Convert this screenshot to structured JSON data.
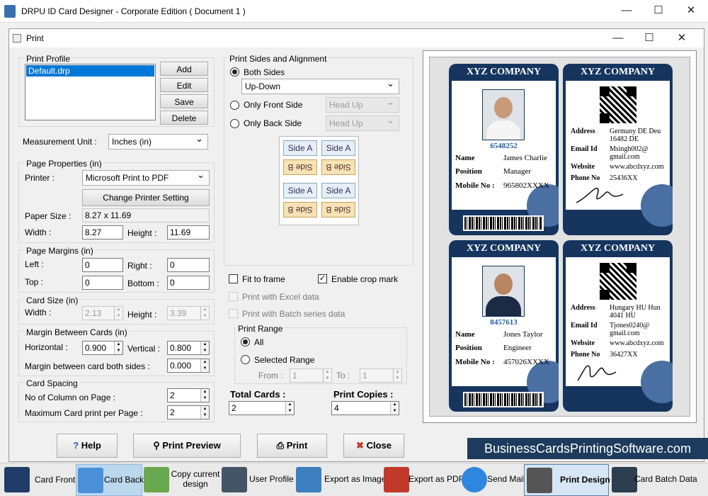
{
  "app": {
    "title": "DRPU ID Card Designer - Corporate Edition ( Document 1 )"
  },
  "dialog": {
    "title": "Print"
  },
  "print_profile": {
    "label": "Print Profile",
    "items": [
      "Default.drp"
    ],
    "add": "Add",
    "edit": "Edit",
    "save": "Save",
    "delete": "Delete"
  },
  "measurement": {
    "label": "Measurement Unit :",
    "value": "Inches (in)"
  },
  "page_properties": {
    "label": "Page Properties (in)",
    "printer_label": "Printer :",
    "printer": "Microsoft Print to PDF",
    "change_printer": "Change Printer Setting",
    "paper_size_label": "Paper Size :",
    "paper_size": "8.27 x 11.69",
    "width_label": "Width :",
    "width": "8.27",
    "height_label": "Height :",
    "height": "11.69"
  },
  "page_margins": {
    "label": "Page Margins (in)",
    "left_label": "Left :",
    "left": "0",
    "right_label": "Right :",
    "right": "0",
    "top_label": "Top :",
    "top": "0",
    "bottom_label": "Bottom :",
    "bottom": "0"
  },
  "card_size": {
    "label": "Card Size (in)",
    "width_label": "Width :",
    "width": "2.13",
    "height_label": "Height :",
    "height": "3.39"
  },
  "margin_between": {
    "label": "Margin Between Cards (in)",
    "horizontal_label": "Horizontal :",
    "horizontal": "0.900",
    "vertical_label": "Vertical :",
    "vertical": "0.800",
    "both_sides_label": "Margin between card both sides :",
    "both_sides": "0.000"
  },
  "card_spacing": {
    "label": "Card Spacing",
    "columns_label": "No of Column on Page :",
    "columns": "2",
    "max_label": "Maximum Card print per Page :",
    "max": "2"
  },
  "sides": {
    "label": "Print Sides and Alignment",
    "both": "Both Sides",
    "both_mode": "Up-Down",
    "front": "Only Front Side",
    "front_mode": "Head Up",
    "back": "Only Back Side",
    "back_mode": "Head Up",
    "side_a": "Side A",
    "side_b": "Side B"
  },
  "options": {
    "fit": "Fit to frame",
    "crop": "Enable crop mark",
    "excel": "Print with Excel data",
    "batch": "Print with Batch series data"
  },
  "range": {
    "label": "Print Range",
    "all": "All",
    "selected": "Selected Range",
    "from_label": "From :",
    "from": "1",
    "to_label": "To :",
    "to": "1"
  },
  "totals": {
    "cards_label": "Total Cards :",
    "cards": "2",
    "copies_label": "Print Copies :",
    "copies": "4"
  },
  "buttons": {
    "help": "Help",
    "preview": "Print Preview",
    "print": "Print",
    "close": "Close"
  },
  "cards": [
    {
      "company": "XYZ COMPANY",
      "id": "6548252",
      "name_label": "Name",
      "name": "James Charlie",
      "position_label": "Position",
      "position": "Manager",
      "mobile_label": "Mobile No :",
      "mobile": "965802XXXX"
    },
    {
      "company": "XYZ COMPANY",
      "address_label": "Address",
      "address": "Germany DE Deu 16482 DE",
      "email_label": "Email Id",
      "email": "Msingh002@ gmail.com",
      "website_label": "Website",
      "website": "www.abcdxyz.com",
      "phone_label": "Phone No",
      "phone": "25436XX"
    },
    {
      "company": "XYZ COMPANY",
      "id": "8457613",
      "name_label": "Name",
      "name": "Jones Taylor",
      "position_label": "Position",
      "position": "Engineer",
      "mobile_label": "Mobile No :",
      "mobile": "457026XXXX"
    },
    {
      "company": "XYZ COMPANY",
      "address_label": "Address",
      "address": "Hungary HU Hun 4041 HU",
      "email_label": "Email Id",
      "email": "Tjones0240@ gmail.com",
      "website_label": "Website",
      "website": "www.abcdxyz.com",
      "phone_label": "Phone No",
      "phone": "36427XX"
    }
  ],
  "watermark": "BusinessCardsPrintingSoftware.com",
  "toolbar": {
    "card_front": "Card Front",
    "card_back": "Card Back",
    "copy_design": "Copy current design",
    "user_profile": "User Profile",
    "export_image": "Export as Image",
    "export_pdf": "Export as PDF",
    "send_mail": "Send Mail",
    "print_design": "Print Design",
    "batch_data": "Card Batch Data"
  }
}
